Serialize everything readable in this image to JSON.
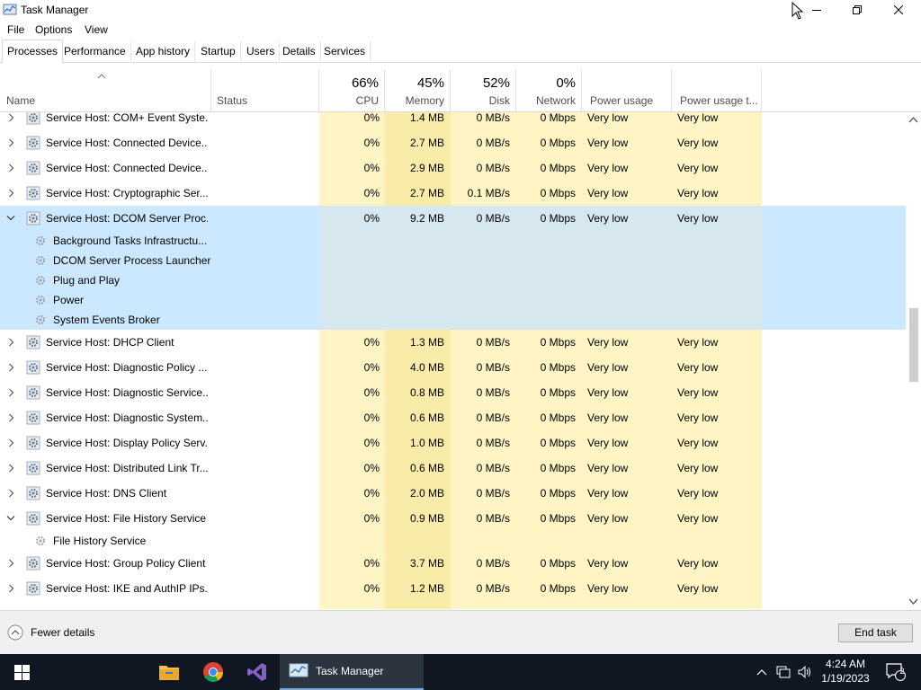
{
  "window": {
    "title": "Task Manager"
  },
  "menu": {
    "items": [
      "File",
      "Options",
      "View"
    ]
  },
  "tabs": [
    "Processes",
    "Performance",
    "App history",
    "Startup",
    "Users",
    "Details",
    "Services"
  ],
  "columns": {
    "name": "Name",
    "status": "Status",
    "cpu": {
      "pct": "66%",
      "label": "CPU"
    },
    "memory": {
      "pct": "45%",
      "label": "Memory"
    },
    "disk": {
      "pct": "52%",
      "label": "Disk"
    },
    "network": {
      "pct": "0%",
      "label": "Network"
    },
    "power": "Power usage",
    "power_trend": "Power usage t..."
  },
  "rows": [
    {
      "name": "Service Host: COM+ Event Syste...",
      "cpu": "0%",
      "memory": "1.4 MB",
      "disk": "0 MB/s",
      "network": "0 Mbps",
      "power": "Very low",
      "trend": "Very low"
    },
    {
      "name": "Service Host: Connected Device...",
      "cpu": "0%",
      "memory": "2.7 MB",
      "disk": "0 MB/s",
      "network": "0 Mbps",
      "power": "Very low",
      "trend": "Very low"
    },
    {
      "name": "Service Host: Connected Device...",
      "cpu": "0%",
      "memory": "2.9 MB",
      "disk": "0 MB/s",
      "network": "0 Mbps",
      "power": "Very low",
      "trend": "Very low"
    },
    {
      "name": "Service Host: Cryptographic Ser...",
      "cpu": "0%",
      "memory": "2.7 MB",
      "disk": "0.1 MB/s",
      "network": "0 Mbps",
      "power": "Very low",
      "trend": "Very low"
    },
    {
      "name": "Service Host: DCOM Server Proc...",
      "cpu": "0%",
      "memory": "9.2 MB",
      "disk": "0 MB/s",
      "network": "0 Mbps",
      "power": "Very low",
      "trend": "Very low"
    },
    {
      "name": "Service Host: DHCP Client",
      "cpu": "0%",
      "memory": "1.3 MB",
      "disk": "0 MB/s",
      "network": "0 Mbps",
      "power": "Very low",
      "trend": "Very low"
    },
    {
      "name": "Service Host: Diagnostic Policy ...",
      "cpu": "0%",
      "memory": "4.0 MB",
      "disk": "0 MB/s",
      "network": "0 Mbps",
      "power": "Very low",
      "trend": "Very low"
    },
    {
      "name": "Service Host: Diagnostic Service...",
      "cpu": "0%",
      "memory": "0.8 MB",
      "disk": "0 MB/s",
      "network": "0 Mbps",
      "power": "Very low",
      "trend": "Very low"
    },
    {
      "name": "Service Host: Diagnostic System...",
      "cpu": "0%",
      "memory": "0.6 MB",
      "disk": "0 MB/s",
      "network": "0 Mbps",
      "power": "Very low",
      "trend": "Very low"
    },
    {
      "name": "Service Host: Display Policy Serv...",
      "cpu": "0%",
      "memory": "1.0 MB",
      "disk": "0 MB/s",
      "network": "0 Mbps",
      "power": "Very low",
      "trend": "Very low"
    },
    {
      "name": "Service Host: Distributed Link Tr...",
      "cpu": "0%",
      "memory": "0.6 MB",
      "disk": "0 MB/s",
      "network": "0 Mbps",
      "power": "Very low",
      "trend": "Very low"
    },
    {
      "name": "Service Host: DNS Client",
      "cpu": "0%",
      "memory": "2.0 MB",
      "disk": "0 MB/s",
      "network": "0 Mbps",
      "power": "Very low",
      "trend": "Very low"
    },
    {
      "name": "Service Host: File History Service",
      "cpu": "0%",
      "memory": "0.9 MB",
      "disk": "0 MB/s",
      "network": "0 Mbps",
      "power": "Very low",
      "trend": "Very low"
    },
    {
      "name": "Service Host: Group Policy Client",
      "cpu": "0%",
      "memory": "3.7 MB",
      "disk": "0 MB/s",
      "network": "0 Mbps",
      "power": "Very low",
      "trend": "Very low"
    },
    {
      "name": "Service Host: IKE and AuthIP IPs...",
      "cpu": "0%",
      "memory": "1.2 MB",
      "disk": "0 MB/s",
      "network": "0 Mbps",
      "power": "Very low",
      "trend": "Very low"
    }
  ],
  "dcom_children": [
    "Background Tasks Infrastructu...",
    "DCOM Server Process Launcher",
    "Plug and Play",
    "Power",
    "System Events Broker"
  ],
  "file_history_children": [
    "File History Service"
  ],
  "footer": {
    "fewer_details": "Fewer details",
    "end_task": "End task"
  },
  "taskbar": {
    "task_manager": "Task Manager",
    "time": "4:24 AM",
    "date": "1/19/2023",
    "notifications": "2"
  },
  "colors": {
    "heat_light": "#fff4c4",
    "heat_medium": "#f9eca8",
    "selected": "#cce8ff",
    "selected_heat": "#d7e7ef"
  }
}
